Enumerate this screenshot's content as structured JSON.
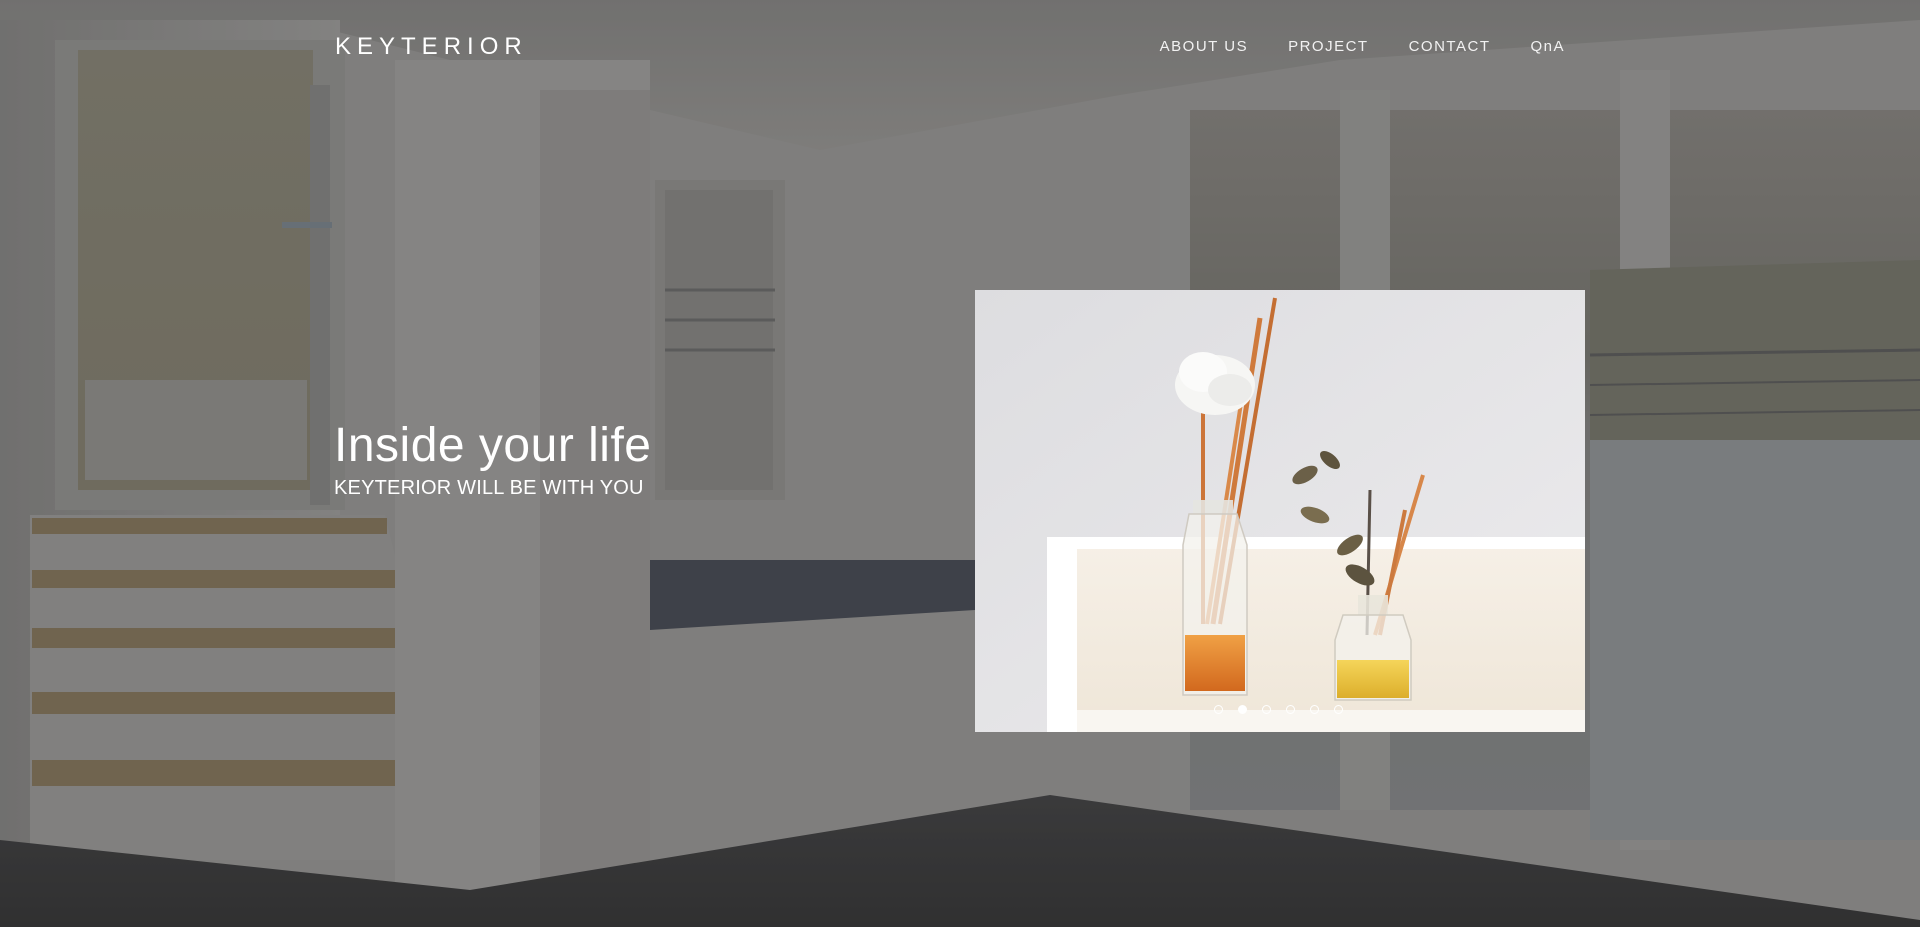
{
  "header": {
    "logo": "KEYTERIOR",
    "nav": [
      {
        "label": "ABOUT US"
      },
      {
        "label": "PROJECT"
      },
      {
        "label": "CONTACT"
      },
      {
        "label": "QnA"
      }
    ]
  },
  "hero": {
    "title": "Inside your life",
    "subtitle": "KEYTERIOR WILL BE WITH YOU"
  },
  "slider": {
    "slide_count": 6,
    "active_index": 1
  },
  "colors": {
    "overlay": "#5f5f5f",
    "text": "#ffffff"
  }
}
